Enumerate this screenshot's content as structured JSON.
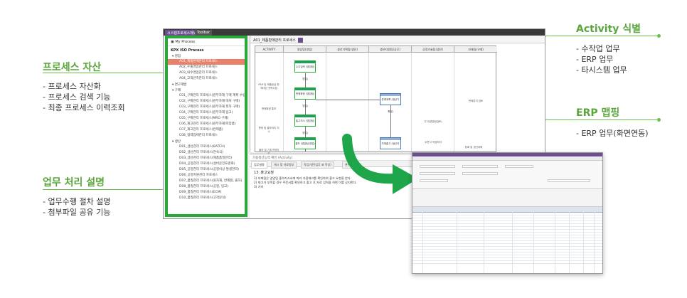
{
  "callouts": {
    "process_asset": {
      "title": "프로세스 자산",
      "items": [
        "- 프로세스 자산화",
        "- 프로세스 검색 기능",
        "- 최종 프로세스 이력조회"
      ]
    },
    "task_desc": {
      "title": "업무 처리 설명",
      "items": [
        "- 업무수행 절차 설명",
        "- 첨부파일 공유 기능"
      ]
    },
    "activity": {
      "title": "Activity 식별",
      "items": [
        "- 수작업 업무",
        "- ERP 업무",
        "- 타시스템 업무"
      ]
    },
    "erp_mapping": {
      "title": "ERP 맵핑",
      "items": [
        "- ERP 업무(화면연동)"
      ]
    }
  },
  "app": {
    "tabs": [
      "시스템프로세스매뉴얼",
      "Toolbar"
    ],
    "tree": {
      "header": "My Process",
      "root": "KPX ISO Process",
      "groups": [
        {
          "label": "▾ 영업",
          "items": [
            "A01_제품판매관리 프로세스",
            "A02_수출영업관리 프로세스",
            "A03_내수영업관리 프로세스",
            "A04_고객만족관리 프로세스"
          ],
          "selected": 0
        },
        {
          "label": "▾ 연구개발",
          "items": []
        },
        {
          "label": "▾ 구매",
          "items": [
            "C01_구매관리 프로세스(원부자재 구매 계획 수립)",
            "C02_구매관리 프로세스(원부자재 대처 구매)",
            "C03_구매관리 프로세스(원부자재 외자 구매)",
            "C04_구매관리 프로세스(원부자재 입고)",
            "C05_구매관리 프로세스(MRO 구매)",
            "C06_재고관리 프로세스(원부자재/저장품)",
            "C07_재고관리 프로세스(완제품)",
            "C08_협력업체관리 프로세스"
          ]
        },
        {
          "label": "▾ 생산",
          "items": [
            "D01_생산관리 프로세스(BATCH)",
            "D02_생산관리 프로세스(연속식)",
            "D03_생산관리 프로세스(제품품질관리)",
            "D04_공정관리 프로세스(설비운전표준화)",
            "D05_공정관리 프로세스(공정이상 발생관리)",
            "D06_공정지원관리 프로세스",
            "D07_품질관리 프로세스(원자재, 반제품, 출하)",
            "D08_품질관리 프로세스(공정, 입고)",
            "D09_품질관리 프로세스(ECM)",
            "D10_품질관리 프로세스(고객문의)"
          ]
        }
      ]
    },
    "diagram": {
      "title": "A01_제품판매관리 프로세스",
      "lanes": [
        "ACTIVITY",
        "영업팀(영업)",
        "생산기획팀(생산)",
        "생산지원팀(공무)",
        "공정기술팀(생산)",
        "자재팀(구매)"
      ],
      "row_labels": [
        "PAR 및 제품공급 판매대상 전략수립",
        "판매확정 통보",
        "판매 및 출하처리 지시",
        "출하 및 기초구매처리"
      ],
      "boxes": [
        "수주입력 (영업팀/영업)",
        "판매확정 (영업팀/영업)",
        "판매계획 (생산기획팀)",
        "출고지시 (영업팀/영업)",
        "출하 (영업팀/영업)",
        "자재출고 (생산지원)"
      ],
      "right_labels": [
        "판매분석 검토",
        "주식(영업팀검토)",
        "주문서 작성처리",
        "등록 및 생산계획"
      ]
    },
    "bottom": {
      "header": "가용생산능력 확인 (Activity)",
      "tabs": [
        "업무설명",
        "게시 및 자료첨부",
        "작업기준(업무 표 작성)",
        "관련 양식"
      ],
      "title": "13. 출고요청",
      "text": [
        "1) 자재팀은 영업팀 출하지시서에 따라 가용재고를 확인하여 출고 요청을 한다.",
        "2) 재고가 부족할 경우 주문서를 확인하고 출고 후 자료 입력을 하며 이를 공지한다.",
        "3) 기타"
      ]
    }
  },
  "colors": {
    "accent_green": "#5aa53c",
    "tree_border": "#2aa83a",
    "selection": "#e8806a",
    "window_bar": "#6b4f8e"
  }
}
